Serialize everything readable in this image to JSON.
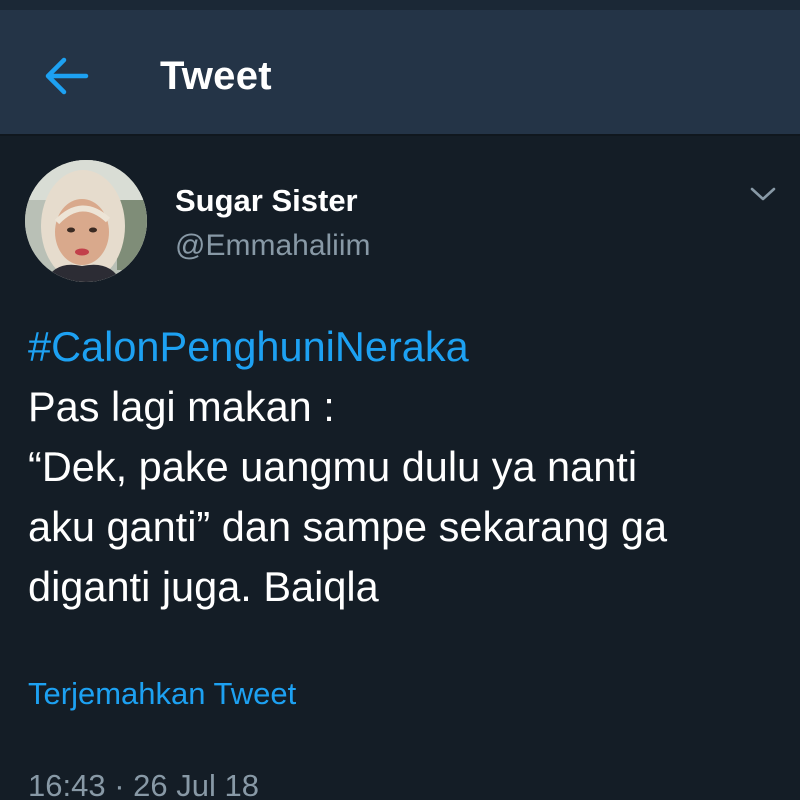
{
  "header": {
    "title": "Tweet",
    "back_icon": "arrow-left-icon"
  },
  "tweet": {
    "author": {
      "display_name": "Sugar Sister",
      "handle": "@Emmahaliim",
      "avatar": "avatar-photo"
    },
    "menu_icon": "chevron-down-icon",
    "hashtag": "#CalonPenghuniNeraka",
    "lines": [
      "Pas lagi makan :",
      "“Dek, pake uangmu dulu ya nanti",
      "aku ganti” dan sampe sekarang ga",
      "diganti juga. Baiqla"
    ],
    "translate_label": "Terjemahkan Tweet",
    "timestamp": "16:43 · 26 Jul 18"
  },
  "colors": {
    "background": "#141d26",
    "header_background": "#243447",
    "accent": "#1da1f2",
    "secondary_text": "#8899a6",
    "primary_text": "#ffffff"
  }
}
